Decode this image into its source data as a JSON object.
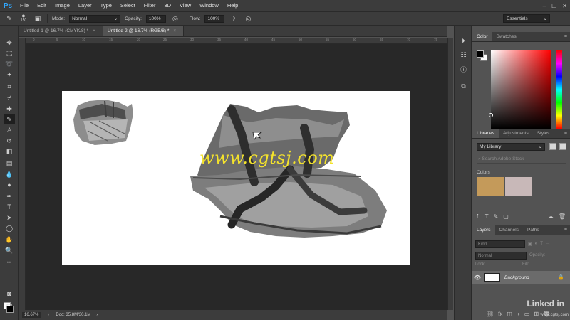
{
  "app": {
    "logo": "Ps",
    "menu": [
      "File",
      "Edit",
      "Image",
      "Layer",
      "Type",
      "Select",
      "Filter",
      "3D",
      "View",
      "Window",
      "Help"
    ],
    "window_controls": [
      "–",
      "☐",
      "✕"
    ]
  },
  "options_bar": {
    "brush_size": "150",
    "mode_label": "Mode:",
    "mode_value": "Normal",
    "opacity_label": "Opacity:",
    "opacity_value": "100%",
    "flow_label": "Flow:",
    "flow_value": "100%",
    "workspace": "Essentials"
  },
  "doc_tabs": [
    {
      "label": "Untitled-1 @ 16.7% (CMYK/8) *",
      "active": false
    },
    {
      "label": "Untitled-2 @ 16.7% (RGB/8) *",
      "active": true
    }
  ],
  "ruler_ticks": [
    "0",
    "5",
    "10",
    "15",
    "20",
    "25",
    "30",
    "35",
    "40",
    "45",
    "50",
    "55",
    "60",
    "65",
    "70",
    "75"
  ],
  "canvas": {
    "watermark": "www.cgtsj.com"
  },
  "status_bar": {
    "zoom": "16.67%",
    "doc_info": "Doc: 35.8M/30.1M"
  },
  "panels": {
    "color": {
      "tabs": [
        "Color",
        "Swatches"
      ],
      "active": "Color"
    },
    "libraries": {
      "tabs": [
        "Libraries",
        "Adjustments",
        "Styles"
      ],
      "active": "Libraries",
      "library_name": "My Library",
      "search_placeholder": "Search Adobe Stock",
      "colors_label": "Colors",
      "colors": [
        "#c49a5a",
        "#c8b8b8"
      ]
    },
    "layers": {
      "tabs": [
        "Layers",
        "Channels",
        "Paths"
      ],
      "active": "Layers",
      "kind_placeholder": "Kind",
      "blend_mode": "Normal",
      "opacity_label": "Opacity:",
      "lock_label": "Lock:",
      "fill_label": "Fill:",
      "layer_name": "Background"
    }
  },
  "branding": {
    "logo": "Linked in",
    "sub": "www.cgtsj.com"
  }
}
